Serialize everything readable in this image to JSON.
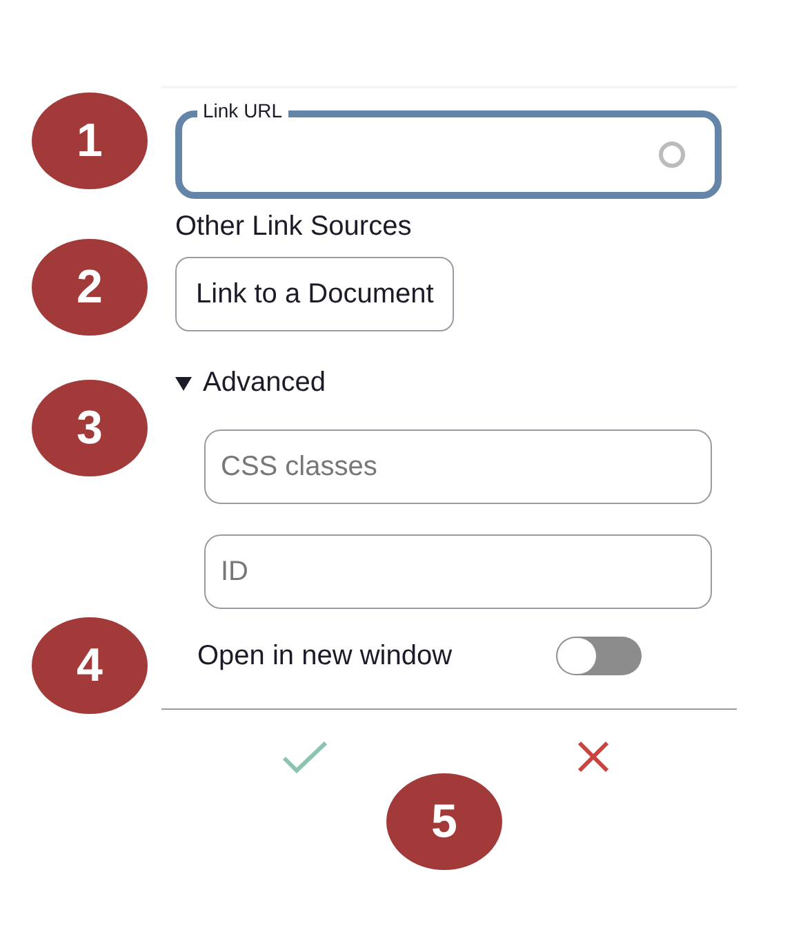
{
  "callouts": [
    "1",
    "2",
    "3",
    "4",
    "5"
  ],
  "url_field": {
    "label": "Link URL",
    "loading": true
  },
  "other_sources": {
    "heading": "Other Link Sources",
    "button": "Link to a Document"
  },
  "advanced": {
    "label": "Advanced",
    "expanded": true,
    "fields": [
      {
        "placeholder": "CSS classes"
      },
      {
        "placeholder": "ID"
      }
    ],
    "toggle": {
      "label": "Open in new window",
      "on": false
    }
  }
}
